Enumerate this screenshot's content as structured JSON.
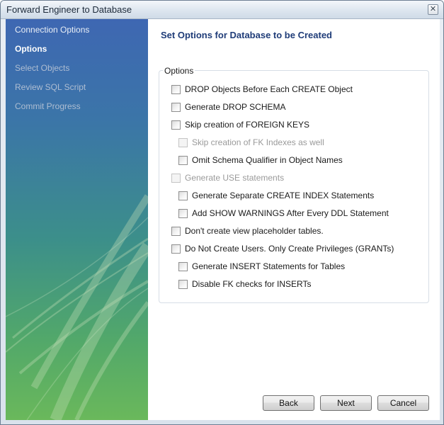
{
  "window": {
    "title": "Forward Engineer to Database",
    "close_glyph": "✕"
  },
  "sidebar": {
    "items": [
      {
        "label": "Connection Options",
        "state": "done"
      },
      {
        "label": "Options",
        "state": "active"
      },
      {
        "label": "Select Objects",
        "state": "pending"
      },
      {
        "label": "Review SQL Script",
        "state": "pending"
      },
      {
        "label": "Commit Progress",
        "state": "pending"
      }
    ]
  },
  "main": {
    "heading": "Set Options for Database to be Created",
    "group_label": "Options",
    "options": [
      {
        "label": "DROP Objects Before Each CREATE Object",
        "checked": false,
        "enabled": true
      },
      {
        "label": "Generate DROP SCHEMA",
        "checked": false,
        "enabled": true
      },
      {
        "label": "Skip creation of FOREIGN KEYS",
        "checked": false,
        "enabled": true
      },
      {
        "label": "Skip creation of FK Indexes as well",
        "checked": false,
        "enabled": false
      },
      {
        "label": "Omit Schema Qualifier in Object Names",
        "checked": false,
        "enabled": true
      },
      {
        "label": "Generate USE statements",
        "checked": false,
        "enabled": false
      },
      {
        "label": "Generate Separate CREATE INDEX Statements",
        "checked": false,
        "enabled": true
      },
      {
        "label": "Add SHOW WARNINGS After Every DDL Statement",
        "checked": false,
        "enabled": true
      },
      {
        "label": "Don't create view placeholder tables.",
        "checked": false,
        "enabled": true
      },
      {
        "label": "Do Not Create Users. Only Create Privileges (GRANTs)",
        "checked": false,
        "enabled": true
      },
      {
        "label": "Generate INSERT Statements for Tables",
        "checked": false,
        "enabled": true
      },
      {
        "label": "Disable FK checks for INSERTs",
        "checked": false,
        "enabled": true
      }
    ]
  },
  "buttons": {
    "back": "Back",
    "next": "Next",
    "cancel": "Cancel"
  }
}
